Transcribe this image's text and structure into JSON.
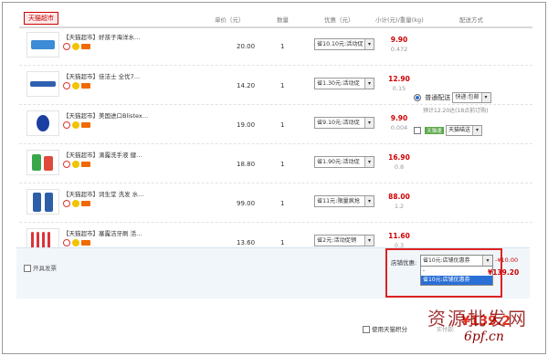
{
  "header": {
    "store_name": "天猫超市",
    "columns": [
      "单价（元）",
      "数量",
      "优惠（元）",
      "小计(元)/重量(kg)",
      "配送方式"
    ]
  },
  "items": [
    {
      "title": "【天猫超市】好孩子海洋水…",
      "price": "20.00",
      "qty": "1",
      "promo": "省10.10元:活动促",
      "subtotal": "9.90",
      "weight": "0.472"
    },
    {
      "title": "【天猫超市】佳洁士 全优7…",
      "price": "14.20",
      "qty": "1",
      "promo": "省1.30元:活动促",
      "subtotal": "12.90",
      "weight": "0.15"
    },
    {
      "title": "【天猫超市】美国进口Blistex…",
      "price": "19.00",
      "qty": "1",
      "promo": "省9.10元:活动促",
      "subtotal": "9.90",
      "weight": "0.004"
    },
    {
      "title": "【天猫超市】滴露洗手液 健…",
      "price": "18.80",
      "qty": "1",
      "promo": "省1.90元:活动促",
      "subtotal": "16.90",
      "weight": "0.8"
    },
    {
      "title": "【天猫超市】词生堂 洗发 水…",
      "price": "99.00",
      "qty": "1",
      "promo": "省11元:限量疯抢",
      "subtotal": "88.00",
      "weight": "1.2"
    },
    {
      "title": "【天猫超市】塞露洁牙刷 活…",
      "price": "13.60",
      "qty": "1",
      "promo": "省2元:活动促销",
      "subtotal": "11.60",
      "weight": "0.3"
    }
  ],
  "shipping": {
    "normal_label": "普通配送",
    "normal_option": "快递:包邮",
    "estimate": "预计12.20达(18点前订购)",
    "tag": "天猫速",
    "express_option": "天猫喵送"
  },
  "footer": {
    "invoice_label": "开具发票",
    "shop_discount_label": "店铺优惠:",
    "shop_discount_value": "省10元:店铺优惠券",
    "dropdown_options": [
      "-",
      "省10元:店铺优惠券"
    ],
    "discount_amount": "-¥10.00",
    "total": "¥139.20",
    "points_label": "使用天猫积分",
    "paid_label": "实付款:",
    "grand_total": "¥139.2"
  },
  "watermark": {
    "line1": "资源批发网",
    "line2": "6pf.cn"
  },
  "colors": {
    "accent": "#cc0000",
    "highlight": "#2a6fd6"
  }
}
